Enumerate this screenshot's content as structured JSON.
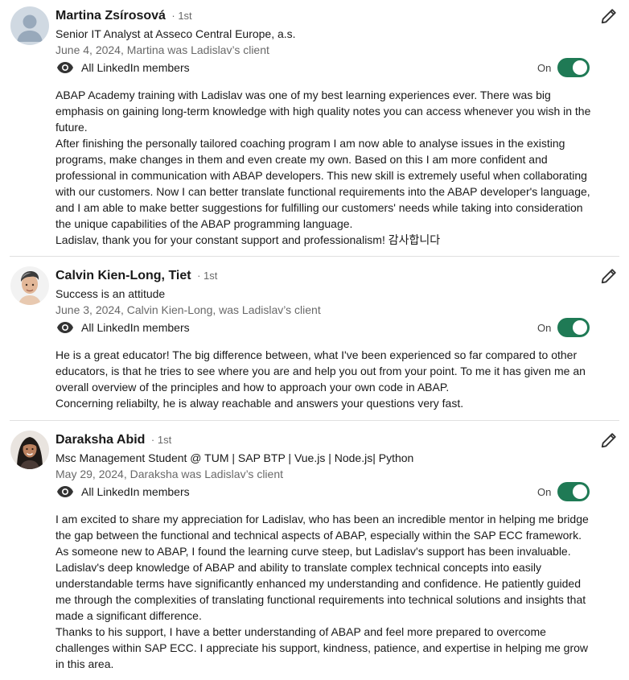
{
  "colors": {
    "toggle_on": "#1f7a55",
    "avatar_placeholder_bg": "#d0d9e2",
    "avatar_placeholder_fg": "#98a9bb"
  },
  "recommendations": [
    {
      "name": "Martina Zsírosová",
      "degree": "· 1st",
      "headline": "Senior IT Analyst at Asseco Central Europe, a.s.",
      "meta": "June 4, 2024, Martina was Ladislav’s client",
      "visibility": "All LinkedIn members",
      "toggle_label": "On",
      "toggle_on": true,
      "avatar": "placeholder-avatar",
      "paragraphs": [
        "ABAP Academy training with Ladislav was one of my best learning experiences ever. There was big emphasis on gaining long-term knowledge with high quality notes you can access whenever you wish in the future.",
        "After finishing the personally tailored coaching program I am now able to analyse issues in the existing programs, make changes in them and even create my own. Based on this I am more confident and professional in communication with ABAP developers. This new skill is extremely useful when collaborating with our customers. Now I can better translate functional requirements into the ABAP developer's language, and I am able to make better suggestions for fulfilling our customers' needs while taking into consideration the unique capabilities of the ABAP programming language.",
        "Ladislav, thank you for your constant support and professionalism! 감사합니다"
      ]
    },
    {
      "name": "Calvin Kien-Long, Tiet",
      "degree": "· 1st",
      "headline": "Success is an attitude",
      "meta": "June 3, 2024, Calvin Kien-Long, was Ladislav’s client",
      "visibility": "All LinkedIn members",
      "toggle_label": "On",
      "toggle_on": true,
      "avatar": "man-photo-avatar",
      "paragraphs": [
        "He is a great educator! The big difference between, what I've been experienced so far compared to other educators, is that he tries to see where you are and help you out from your point. To me it has given me an overall overview of the principles and how to approach your own code in ABAP.",
        "Concerning reliabilty, he is alway reachable and answers your questions very fast."
      ]
    },
    {
      "name": "Daraksha Abid",
      "degree": "· 1st",
      "headline": "Msc Management Student @ TUM | SAP BTP | Vue.js | Node.js| Python",
      "meta": "May 29, 2024, Daraksha was Ladislav’s client",
      "visibility": "All LinkedIn members",
      "toggle_label": "On",
      "toggle_on": true,
      "avatar": "woman-photo-avatar",
      "paragraphs": [
        "I am excited to share my appreciation for Ladislav, who has been an incredible mentor in helping me bridge the gap between the functional and technical aspects of ABAP, especially within the SAP ECC framework. As someone new to ABAP, I found the learning curve steep, but Ladislav's support has been invaluable. Ladislav's deep knowledge of ABAP and ability to translate complex technical concepts into easily understandable terms have significantly enhanced my understanding and confidence. He patiently guided me through the complexities of translating functional requirements into technical solutions and insights that made a significant difference.",
        "Thanks to his support, I have a better understanding of ABAP and feel more prepared to overcome challenges within SAP ECC. I appreciate his support, kindness, patience, and expertise in helping me grow in this area."
      ]
    }
  ]
}
